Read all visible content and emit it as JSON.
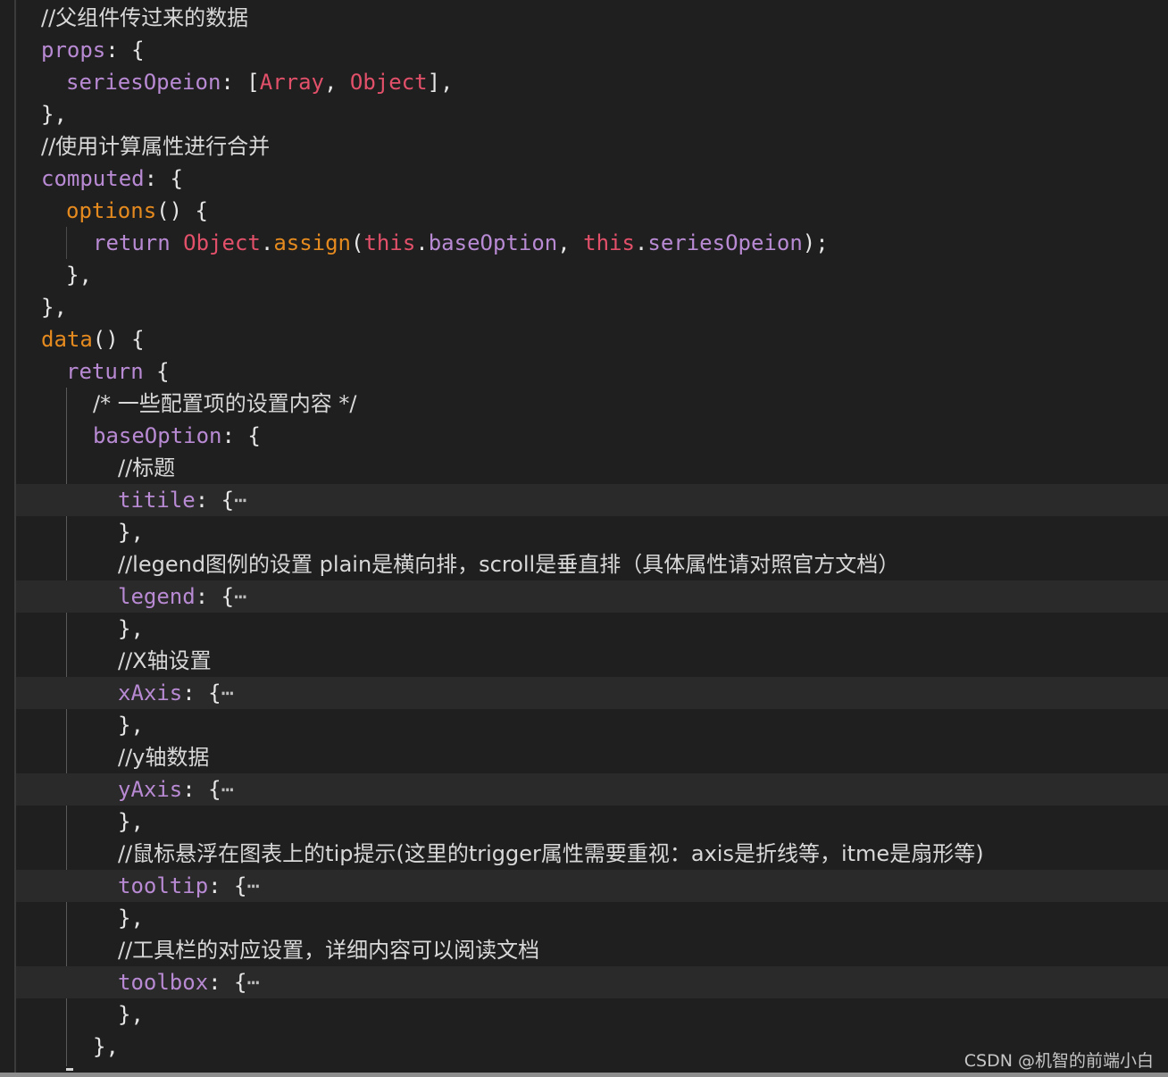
{
  "editor": {
    "lines": [
      {
        "comment": "//父组件传过来的数据"
      },
      {
        "key": "props",
        "rest": ": {"
      },
      {
        "key": "seriesOpeion",
        "mid": ": [",
        "type1": "Array",
        "comma": ", ",
        "type2": "Object",
        "end": "],"
      },
      {
        "text": "},"
      },
      {
        "comment": "//使用计算属性进行合并"
      },
      {
        "key": "computed",
        "rest": ": {"
      },
      {
        "fn": "options",
        "rest": "() {"
      },
      {
        "ret": "return",
        "obj": "Object",
        "dot1": ".",
        "assign": "assign",
        "paren": "(",
        "this1": "this",
        "dot2": ".",
        "arg1": "baseOption",
        "comma": ", ",
        "this2": "this",
        "dot3": ".",
        "arg2": "seriesOpeion",
        "end": ");"
      },
      {
        "text": "},"
      },
      {
        "text": "},"
      },
      {
        "fn": "data",
        "rest": "() {"
      },
      {
        "ret": "return",
        "rest": " {"
      },
      {
        "comment": "/* 一些配置项的设置内容 */"
      },
      {
        "key": "baseOption",
        "rest": ": {"
      },
      {
        "comment": "//标题"
      },
      {
        "key": "titile",
        "rest": ": {",
        "ellipsis": "⋯"
      },
      {
        "text": "},"
      },
      {
        "comment": "//legend图例的设置 plain是横向排，scroll是垂直排（具体属性请对照官方文档）"
      },
      {
        "key": "legend",
        "rest": ": {",
        "ellipsis": "⋯"
      },
      {
        "text": "},"
      },
      {
        "comment": "//X轴设置"
      },
      {
        "key": "xAxis",
        "rest": ": {",
        "ellipsis": "⋯"
      },
      {
        "text": "},"
      },
      {
        "comment": "//y轴数据"
      },
      {
        "key": "yAxis",
        "rest": ": {",
        "ellipsis": "⋯"
      },
      {
        "text": "},"
      },
      {
        "comment": "//鼠标悬浮在图表上的tip提示(这里的trigger属性需要重视：axis是折线等，itme是扇形等)"
      },
      {
        "key": "tooltip",
        "rest": ": {",
        "ellipsis": "⋯"
      },
      {
        "text": "},"
      },
      {
        "comment": "//工具栏的对应设置，详细内容可以阅读文档"
      },
      {
        "key": "toolbox",
        "rest": ": {",
        "ellipsis": "⋯"
      },
      {
        "text": "},"
      },
      {
        "text": "},"
      }
    ]
  },
  "watermark": "CSDN @机智的前端小白",
  "colors": {
    "background": "#1f1f1f",
    "folded_line_bg": "#2a2a2a",
    "property": "#b98ad4",
    "keyword_orange": "#e58a1f",
    "keyword_red": "#e2506a",
    "text": "#e6e6e6"
  }
}
